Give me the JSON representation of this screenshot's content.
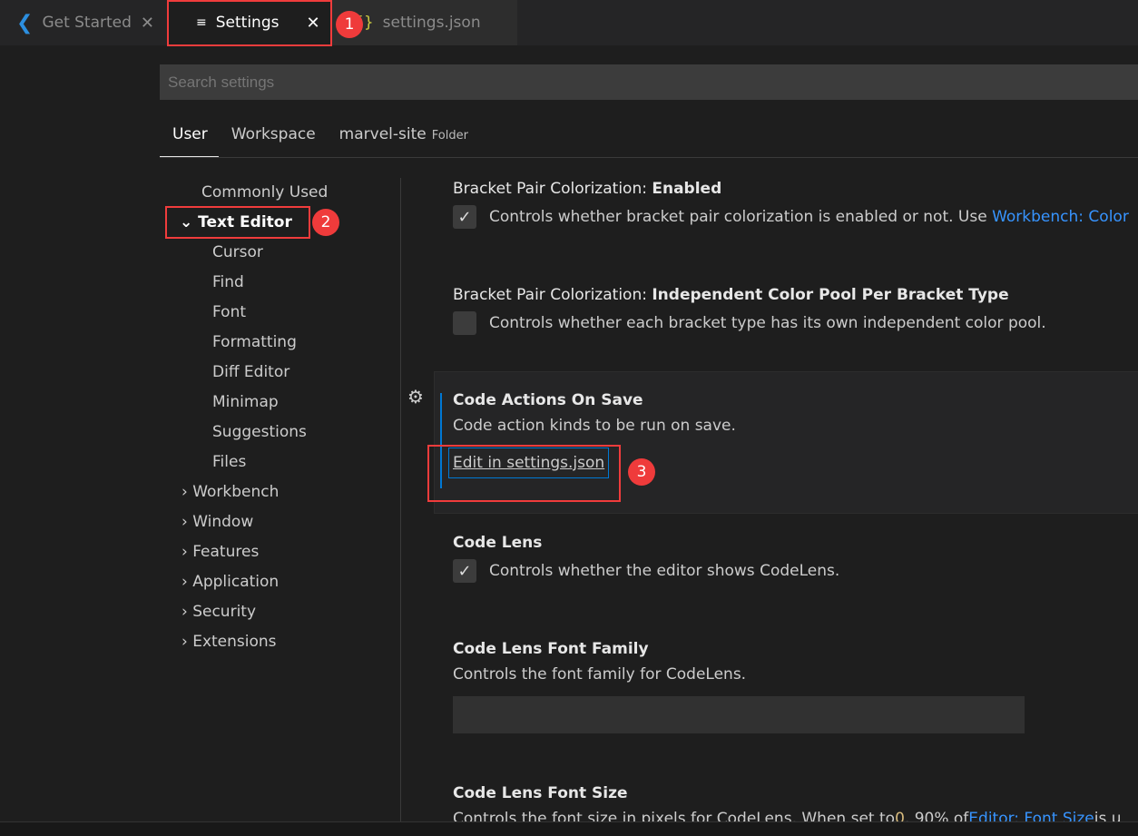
{
  "tabs": [
    {
      "label": "Get Started",
      "icon": "vscode-logo-icon"
    },
    {
      "label": "Settings",
      "icon": "settings-lines-icon",
      "active": true
    },
    {
      "label": "settings.json",
      "icon": "json-braces-icon"
    }
  ],
  "search": {
    "placeholder": "Search settings"
  },
  "scopes": [
    {
      "label": "User"
    },
    {
      "label": "Workspace"
    },
    {
      "label": "marvel-site",
      "tag": "Folder"
    }
  ],
  "toc": {
    "items": [
      "Commonly Used",
      "Text Editor",
      "Cursor",
      "Find",
      "Font",
      "Formatting",
      "Diff Editor",
      "Minimap",
      "Suggestions",
      "Files",
      "Workbench",
      "Window",
      "Features",
      "Application",
      "Security",
      "Extensions"
    ]
  },
  "settings": [
    {
      "cat": "Bracket Pair Colorization: ",
      "name": "Enabled",
      "desc": "Controls whether bracket pair colorization is enabled or not. Use ",
      "link": "Workbench: Color",
      "checked": true
    },
    {
      "cat": "Bracket Pair Colorization: ",
      "name": "Independent Color Pool Per Bracket Type",
      "desc": "Controls whether each bracket type has its own independent color pool.",
      "checked": false
    },
    {
      "name": "Code Actions On Save",
      "desc": "Code action kinds to be run on save.",
      "action": "Edit in settings.json"
    },
    {
      "name": "Code Lens",
      "desc": "Controls whether the editor shows CodeLens.",
      "checked": true
    },
    {
      "name": "Code Lens Font Family",
      "desc": "Controls the font family for CodeLens.",
      "value": ""
    },
    {
      "name": "Code Lens Font Size",
      "desc": "Controls the font size in pixels for CodeLens. When set to ",
      "code": "0",
      "desc2": ", 90% of ",
      "link": "Editor: Font Size",
      "desc3": " is u"
    }
  ],
  "annotations": [
    "1",
    "2",
    "3"
  ],
  "colors": {
    "accent": "#0078d4",
    "link": "#3794ff",
    "annotation": "#ef3b3b"
  }
}
